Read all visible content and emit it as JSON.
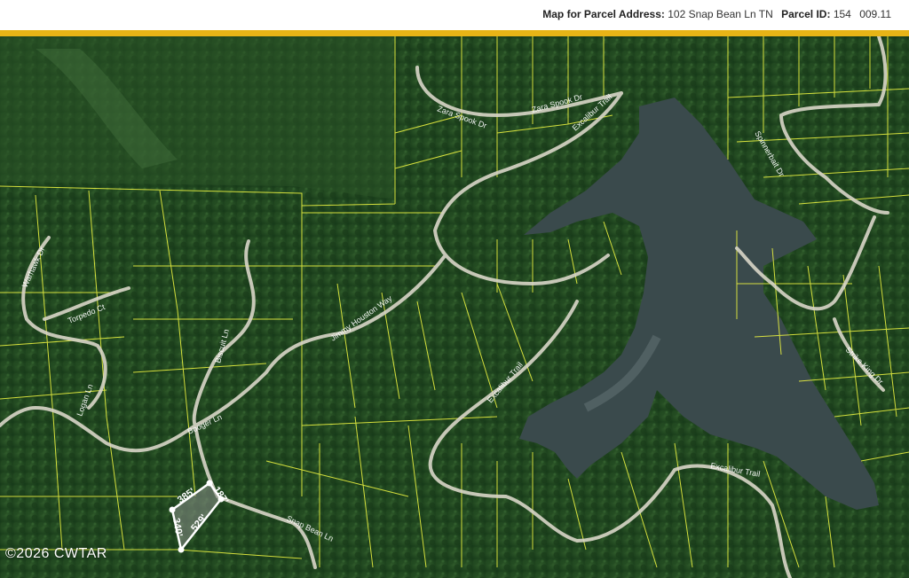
{
  "header": {
    "address_label": "Map for Parcel Address:",
    "address_value": "102 Snap Bean Ln TN",
    "parcel_label": "Parcel ID:",
    "parcel_a": "154",
    "parcel_b": "009.11"
  },
  "colors": {
    "accent": "#e7b416",
    "parcel_line": "#e8f040",
    "lake": "#3a4a4c"
  },
  "roads": [
    {
      "name": "road-warhawk",
      "text": "Warhawk Dr"
    },
    {
      "name": "road-torpedo",
      "text": "Torpedo Ct"
    },
    {
      "name": "road-biscuit",
      "text": "Biscuit Ln"
    },
    {
      "name": "road-booger",
      "text": "Booger Ln"
    },
    {
      "name": "road-jimmy-houston",
      "text": "Jimmy Houston Way"
    },
    {
      "name": "road-zara-spook-1",
      "text": "Zara Spook Dr"
    },
    {
      "name": "road-zara-spook-2",
      "text": "Zara Spook Dr"
    },
    {
      "name": "road-excalibur-1",
      "text": "Excalibur Trail"
    },
    {
      "name": "road-excalibur-2",
      "text": "Excalibur Trail"
    },
    {
      "name": "road-excalibur-3",
      "text": "Excalibur Trail"
    },
    {
      "name": "road-snap-bean",
      "text": "Snap Bean Ln"
    },
    {
      "name": "road-logan",
      "text": "Logan Ln"
    },
    {
      "name": "road-strike-king",
      "text": "Strike King Dr"
    },
    {
      "name": "road-spinnerbait",
      "text": "Spinnerbait Dr"
    }
  ],
  "dimensions": [
    "385'",
    "187'",
    "340'",
    "529'"
  ],
  "watermark": "©2026 CWTAR"
}
